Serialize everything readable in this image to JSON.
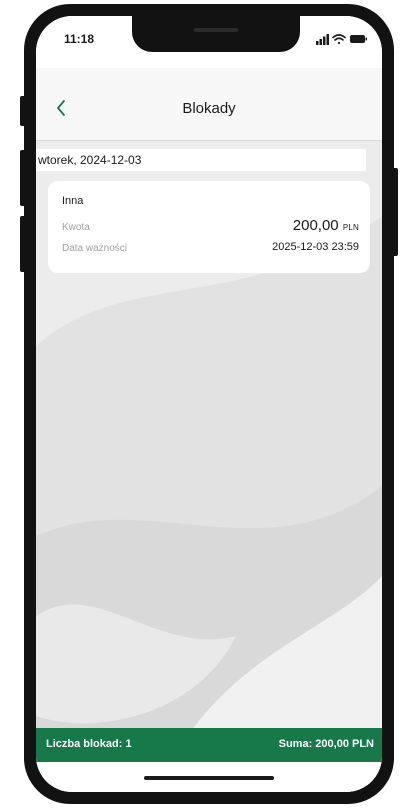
{
  "status_bar": {
    "time": "11:18",
    "icons": [
      "signal-icon",
      "wifi-icon",
      "battery-icon"
    ]
  },
  "header": {
    "title": "Blokady",
    "back_icon": "chevron-left-icon",
    "accent_color": "#17784a"
  },
  "date_header": "wtorek, 2024-12-03",
  "block_item": {
    "type": "Inna",
    "amount_label": "Kwota",
    "amount_value": "200,00",
    "amount_currency": "PLN",
    "expiry_label": "Data ważności",
    "expiry_value": "2025-12-03 23:59"
  },
  "summary": {
    "count_text": "Liczba blokad: 1",
    "sum_text": "Suma: 200,00 PLN",
    "background": "#17784a"
  }
}
